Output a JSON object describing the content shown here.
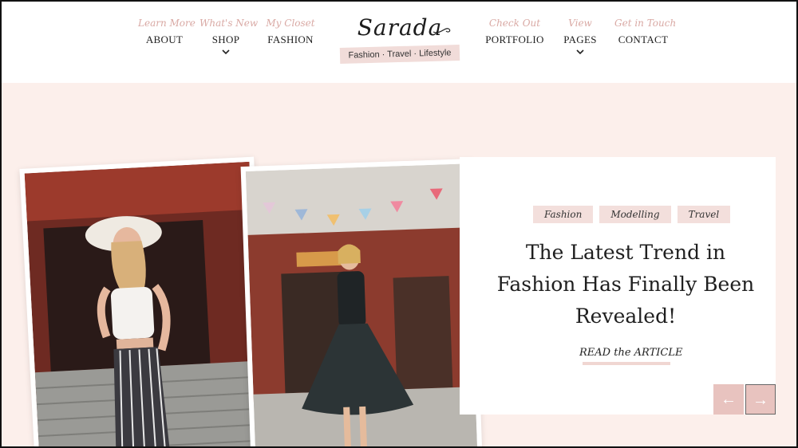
{
  "colors": {
    "page_bg": "#fcefeb",
    "accent_pink": "#d9a9a4",
    "tag_bg": "#f3dfdc",
    "arrow_bg": "#e8c3bf"
  },
  "nav": {
    "left": [
      {
        "sub": "Learn More",
        "label": "ABOUT",
        "dropdown": false
      },
      {
        "sub": "What's New",
        "label": "SHOP",
        "dropdown": true
      },
      {
        "sub": "My Closet",
        "label": "FASHION",
        "dropdown": false
      }
    ],
    "right": [
      {
        "sub": "Check Out",
        "label": "PORTFOLIO",
        "dropdown": false
      },
      {
        "sub": "View",
        "label": "PAGES",
        "dropdown": true
      },
      {
        "sub": "Get in Touch",
        "label": "CONTACT",
        "dropdown": false
      }
    ]
  },
  "logo": {
    "name": "Sarada",
    "tagline": "Fashion · Travel · Lifestyle"
  },
  "hero": {
    "tags": [
      "Fashion",
      "Modelling",
      "Travel"
    ],
    "headline": "The Latest Trend in Fashion Has Finally Been Revealed!",
    "link_label": "READ the ARTICLE",
    "prev_icon": "arrow-left-icon",
    "next_icon": "arrow-right-icon",
    "prev_glyph": "←",
    "next_glyph": "→"
  }
}
